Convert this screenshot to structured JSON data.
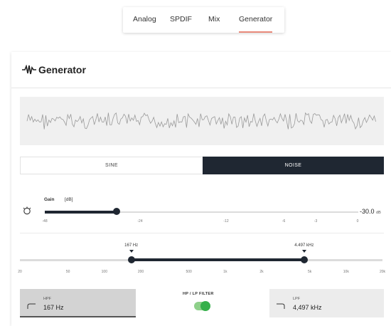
{
  "tabs": [
    {
      "label": "Analog",
      "active": false
    },
    {
      "label": "SPDIF",
      "active": false
    },
    {
      "label": "Mix",
      "active": false
    },
    {
      "label": "Generator",
      "active": true
    }
  ],
  "panel": {
    "title": "Generator",
    "title_icon": "waveform-icon"
  },
  "modes": {
    "sine_label": "SINE",
    "noise_label": "NOISE",
    "selected": "NOISE"
  },
  "gain": {
    "icon": "dial-icon",
    "label": "Gain",
    "unit": "[dB]",
    "value_number": "-30.0",
    "value_unit": "dB",
    "value": -30.0,
    "min": -48,
    "max": 0,
    "ticks": [
      "-48",
      "-24",
      "-12",
      "-6",
      "-3",
      "0"
    ]
  },
  "filter": {
    "hpf_marker": "167 Hz",
    "lpf_marker": "4.497 kHz",
    "hpf_hz": 167,
    "lpf_hz": 4497,
    "ticks": [
      "20",
      "50",
      "100",
      "200",
      "500",
      "1k",
      "2k",
      "5k",
      "10k",
      "20k"
    ],
    "hpf": {
      "title": "HPF",
      "value": "167 Hz",
      "icon": "high-pass-icon"
    },
    "lpf": {
      "title": "LPF",
      "value": "4,497 kHz",
      "icon": "low-pass-icon"
    },
    "toggle_label": "HP / LP FILTER",
    "toggle_on": true
  },
  "colors": {
    "accent_dark": "#1f2732",
    "active_tab_underline": "#e9897a",
    "toggle_green": "#35b04a"
  }
}
